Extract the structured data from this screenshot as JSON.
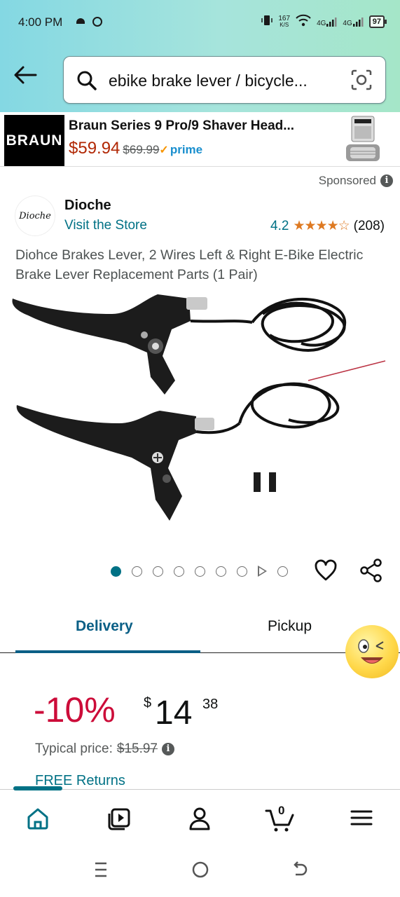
{
  "status_bar": {
    "time": "4:00 PM",
    "net_speed_value": "167",
    "net_speed_unit": "K/S",
    "net1": "4G",
    "net2": "4G",
    "battery": "97"
  },
  "search": {
    "query": "ebike brake lever / bicycle..."
  },
  "sponsored_banner": {
    "brand_logo_text": "BRAUN",
    "title": "Braun Series 9 Pro/9 Shaver Head...",
    "price": "$59.94",
    "list_price": "$69.99",
    "prime_label": "prime"
  },
  "sponsored_label": "Sponsored",
  "seller": {
    "logo_text": "Dioche",
    "name": "Dioche",
    "visit_store": "Visit the Store",
    "rating": "4.2",
    "stars": "★★★★☆",
    "review_count": "(208)"
  },
  "product": {
    "title": "Diohce Brakes Lever, 2 Wires Left & Right E-Bike Electric Brake Lever Replacement Parts (1 Pair)"
  },
  "gallery": {
    "dot_count": 9,
    "active_index": 0
  },
  "tabs": {
    "delivery": "Delivery",
    "pickup": "Pickup"
  },
  "pricing": {
    "discount": "-10%",
    "currency_symbol": "$",
    "price_whole": "14",
    "price_fraction": "38",
    "typical_label": "Typical price:",
    "typical_price": "$15.97",
    "free_returns": "FREE Returns"
  },
  "bottom_nav": {
    "cart_count": "0"
  },
  "colors": {
    "link": "#007185",
    "discount": "#cc0c39",
    "star": "#de7921",
    "prime": "#1a8fce",
    "tab_active": "#0a5f86"
  }
}
